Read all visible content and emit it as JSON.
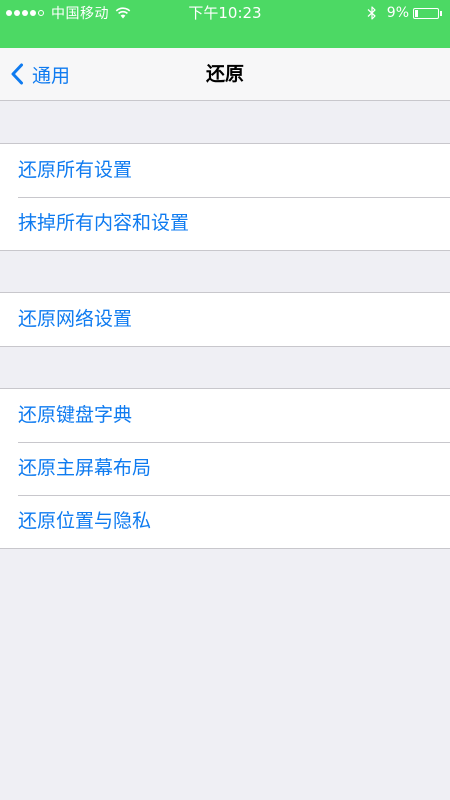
{
  "status_bar": {
    "carrier": "中国移动",
    "time": "下午10:23",
    "battery_percent": "9%",
    "battery_level": 0.09,
    "signal_strength": 4,
    "signal_max": 5
  },
  "nav": {
    "back_label": "通用",
    "title": "还原"
  },
  "groups": [
    {
      "items": [
        "还原所有设置",
        "抹掉所有内容和设置"
      ]
    },
    {
      "items": [
        "还原网络设置"
      ]
    },
    {
      "items": [
        "还原键盘字典",
        "还原主屏幕布局",
        "还原位置与隐私"
      ]
    }
  ],
  "colors": {
    "status_bar_bg": "#4cd964",
    "accent": "#0f7bf0",
    "background": "#efeff4"
  },
  "icons": [
    "signal-dots-icon",
    "wifi-icon",
    "bluetooth-icon",
    "battery-icon",
    "chevron-left-icon"
  ]
}
